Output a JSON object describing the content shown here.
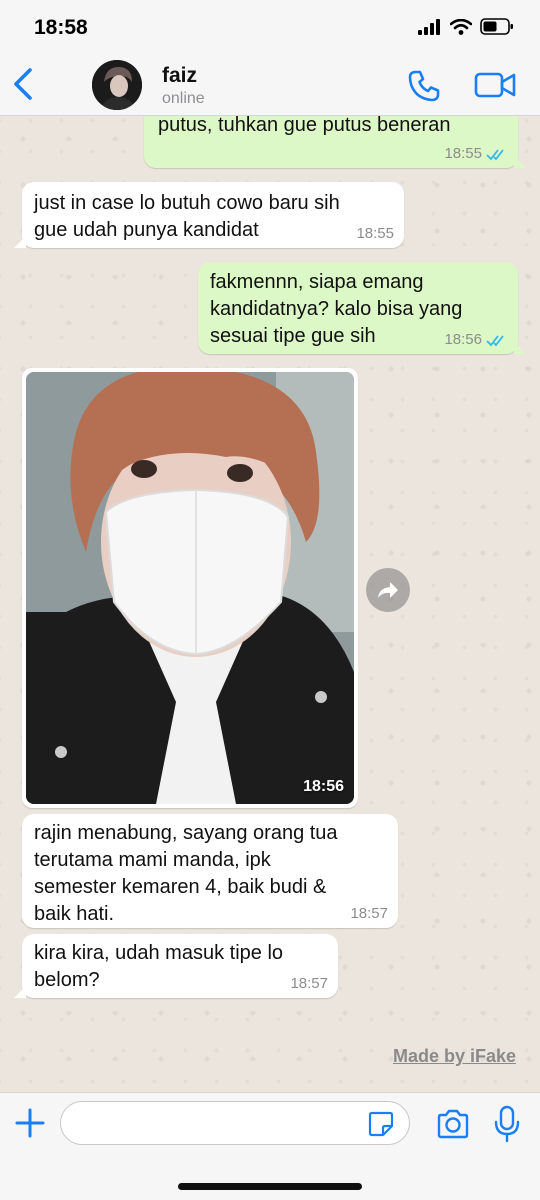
{
  "status_bar": {
    "time": "18:58"
  },
  "header": {
    "contact_name": "faiz",
    "contact_status": "online"
  },
  "colors": {
    "accent": "#1a7ff5",
    "outgoing_bubble": "#dcf8c6",
    "incoming_bubble": "#ffffff",
    "read_ticks": "#34b7f1"
  },
  "messages": [
    {
      "direction": "out",
      "text": "putus, tuhkan gue putus beneran",
      "time": "18:55",
      "read": true
    },
    {
      "direction": "in",
      "text": "just in case lo butuh cowo baru sih\ngue udah punya kandidat",
      "time": "18:55"
    },
    {
      "direction": "out",
      "text": "fakmennn, siapa emang\nkandidatnya? kalo bisa yang\nsesuai tipe gue sih",
      "time": "18:56",
      "read": true
    },
    {
      "direction": "in",
      "type": "photo",
      "time": "18:56"
    },
    {
      "direction": "in",
      "text": "rajin menabung, sayang orang tua\nterutama mami manda, ipk\nsemester kemaren 4, baik budi &\nbaik hati.",
      "time": "18:57"
    },
    {
      "direction": "in",
      "text": "kira kira, udah masuk tipe lo\nbelom?",
      "time": "18:57"
    }
  ],
  "watermark": "Made by iFake",
  "input": {
    "placeholder": ""
  },
  "icons": [
    "back-chevron-icon",
    "phone-icon",
    "video-camera-icon",
    "forward-icon",
    "plus-icon",
    "sticker-icon",
    "camera-icon",
    "microphone-icon",
    "double-check-icon"
  ]
}
